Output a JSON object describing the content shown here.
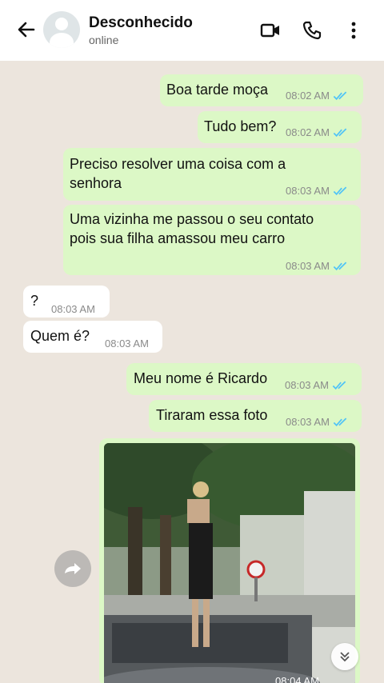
{
  "header": {
    "contact_name": "Desconhecido",
    "status": "online",
    "icons": [
      "back-arrow-icon",
      "default-avatar-icon",
      "video-call-icon",
      "phone-icon",
      "more-vertical-icon"
    ]
  },
  "messages": [
    {
      "direction": "out",
      "text": "Boa tarde moça",
      "time": "08:02 AM",
      "read": true
    },
    {
      "direction": "out",
      "text": "Tudo bem?",
      "time": "08:02 AM",
      "read": true
    },
    {
      "direction": "out",
      "text": "Preciso resolver uma coisa com a senhora",
      "time": "08:03 AM",
      "read": true
    },
    {
      "direction": "out",
      "text": "Uma vizinha me passou o seu contato pois sua filha amassou meu carro",
      "time": "08:03 AM",
      "read": true
    },
    {
      "direction": "in",
      "text": "?",
      "time": "08:03 AM"
    },
    {
      "direction": "in",
      "text": "Quem é?",
      "time": "08:03 AM"
    },
    {
      "direction": "out",
      "text": "Meu nome é Ricardo",
      "time": "08:03 AM",
      "read": true
    },
    {
      "direction": "out",
      "text": "Tiraram essa foto",
      "time": "08:03 AM",
      "read": true
    },
    {
      "direction": "out",
      "type": "image",
      "time": "08:04 AM",
      "image_desc": "photo-of-woman-standing-on-car-under-trees"
    }
  ],
  "colors": {
    "outgoing_bubble": "#dcf8c6",
    "incoming_bubble": "#ffffff",
    "chat_background": "#ece5dd",
    "read_ticks": "#4fc3f7"
  }
}
